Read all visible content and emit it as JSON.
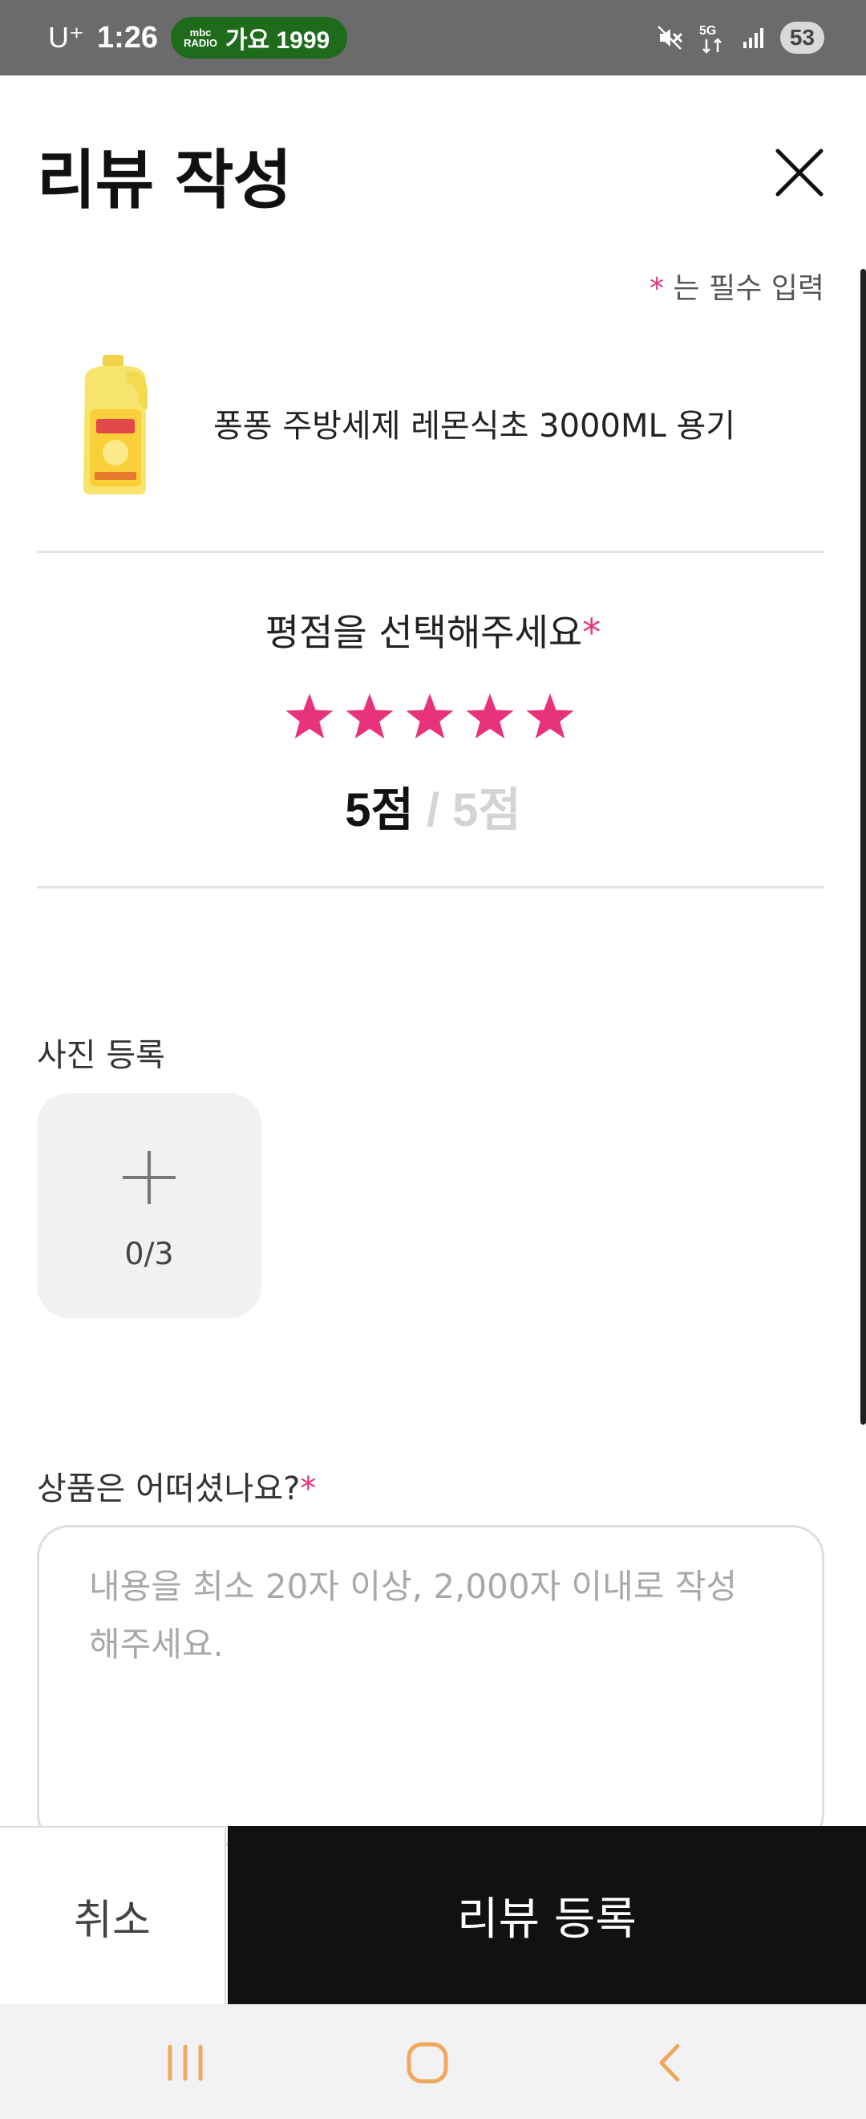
{
  "status_bar": {
    "carrier": "U⁺",
    "time": "1:26",
    "radio_logo_line1": "mbc",
    "radio_logo_line2": "RADIO",
    "radio_text": "가요 1999",
    "network": "5G",
    "battery": "53"
  },
  "header": {
    "title": "리뷰 작성"
  },
  "required_note": {
    "mark": "*",
    "text": " 는 필수 입력"
  },
  "product": {
    "name": "퐁퐁 주방세제 레몬식초 3000ML 용기"
  },
  "rating": {
    "title": "평점을 선택해주세요",
    "required_mark": "*",
    "stars_selected": 5,
    "stars_total": 5,
    "score_label": "5점",
    "separator": " / ",
    "max_label": "5점",
    "star_color": "#E8327B"
  },
  "photo": {
    "label": "사진 등록",
    "count": "0/3"
  },
  "review": {
    "label": "상품은 어떠셨나요?",
    "required_mark": "*",
    "placeholder": "내용을 최소 20자 이상, 2,000자 이내로 작성해주세요."
  },
  "actions": {
    "cancel_label": "취소",
    "submit_label": "리뷰 등록"
  },
  "colors": {
    "accent": "#E8327B",
    "submit_bg": "#111111",
    "radio_pill": "#1F6B1C"
  },
  "nav_icons": [
    "recent-apps-icon",
    "home-icon",
    "back-icon"
  ]
}
